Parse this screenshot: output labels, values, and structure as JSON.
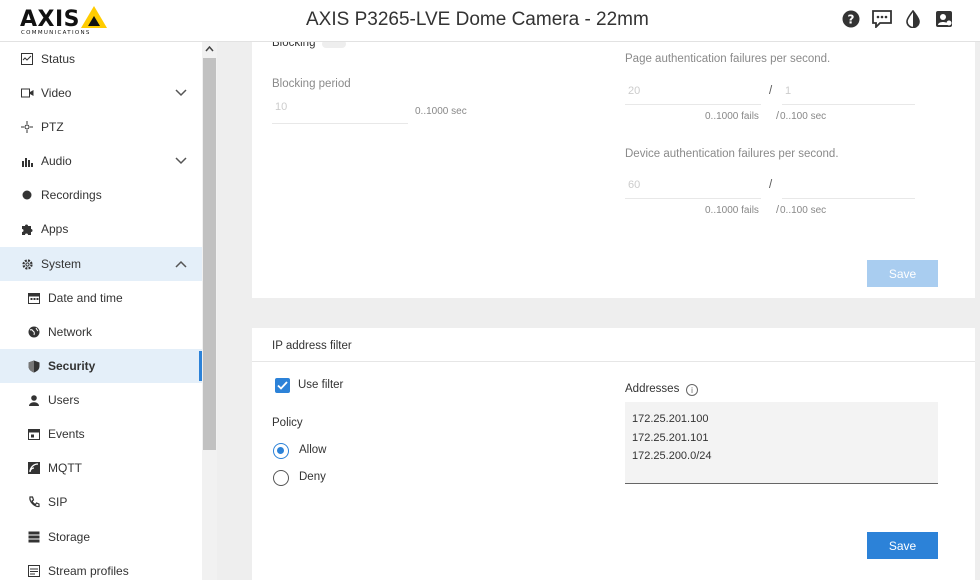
{
  "brand": {
    "logo_word": "AXIS",
    "logo_sub": "COMMUNICATIONS",
    "accent": "#ffcc00"
  },
  "header": {
    "title": "AXIS P3265-LVE Dome Camera - 22mm",
    "icons": [
      "help-icon",
      "feedback-icon",
      "contrast-icon",
      "user-account-icon"
    ]
  },
  "sidebar": {
    "items": [
      {
        "label": "Status",
        "icon": "status-icon"
      },
      {
        "label": "Video",
        "icon": "video-icon",
        "expandable": true
      },
      {
        "label": "PTZ",
        "icon": "ptz-icon"
      },
      {
        "label": "Audio",
        "icon": "audio-icon",
        "expandable": true
      },
      {
        "label": "Recordings",
        "icon": "recordings-icon"
      },
      {
        "label": "Apps",
        "icon": "apps-icon"
      },
      {
        "label": "System",
        "icon": "gear-icon",
        "expanded": true
      }
    ],
    "system_children": [
      {
        "label": "Date and time",
        "icon": "calendar-icon"
      },
      {
        "label": "Network",
        "icon": "globe-icon"
      },
      {
        "label": "Security",
        "icon": "shield-icon",
        "active": true
      },
      {
        "label": "Users",
        "icon": "user-icon"
      },
      {
        "label": "Events",
        "icon": "events-icon"
      },
      {
        "label": "MQTT",
        "icon": "mqtt-icon"
      },
      {
        "label": "SIP",
        "icon": "sip-icon"
      },
      {
        "label": "Storage",
        "icon": "storage-icon"
      },
      {
        "label": "Stream profiles",
        "icon": "stream-icon"
      }
    ]
  },
  "brute_force": {
    "blocking_label": "Blocking",
    "blocking_period_label": "Blocking period",
    "blocking_period_value": "10",
    "blocking_period_hint": "0..1000 sec",
    "page_auth_label": "Page authentication failures per second.",
    "page_auth_fails": "20",
    "page_auth_secs": "1",
    "device_auth_label": "Device authentication failures per second.",
    "device_auth_fails": "60",
    "device_auth_secs": "",
    "separator": "/",
    "fails_hint": "0..1000 fails",
    "secs_hint": "0..100 sec",
    "save_label": "Save"
  },
  "ip_filter": {
    "title": "IP address filter",
    "use_filter_label": "Use filter",
    "use_filter_checked": true,
    "policy_label": "Policy",
    "policy_options": [
      "Allow",
      "Deny"
    ],
    "policy_selected": "Allow",
    "addresses_label": "Addresses",
    "addresses": [
      "172.25.201.100",
      "172.25.201.101",
      "172.25.200.0/24"
    ],
    "save_label": "Save"
  },
  "colors": {
    "primary": "#2c82d8",
    "selected_bg": "#e4eff9"
  }
}
